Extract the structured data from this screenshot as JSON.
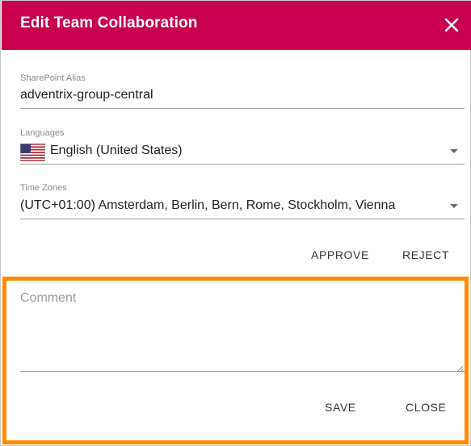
{
  "dialog": {
    "title": "Edit Team Collaboration",
    "header_color": "#c8004e",
    "highlight_color": "#ff8a00"
  },
  "fields": {
    "sharepoint_alias": {
      "label": "SharePoint Alias",
      "value": "adventrix-group-central"
    },
    "languages": {
      "label": "Languages",
      "value": "English (United States)",
      "icon": "us-flag-icon"
    },
    "time_zones": {
      "label": "Time Zones",
      "value": "(UTC+01:00) Amsterdam, Berlin, Bern, Rome, Stockholm, Vienna"
    }
  },
  "actions": {
    "approve": "APPROVE",
    "reject": "REJECT"
  },
  "comment": {
    "placeholder": "Comment",
    "save": "SAVE",
    "close": "CLOSE"
  }
}
